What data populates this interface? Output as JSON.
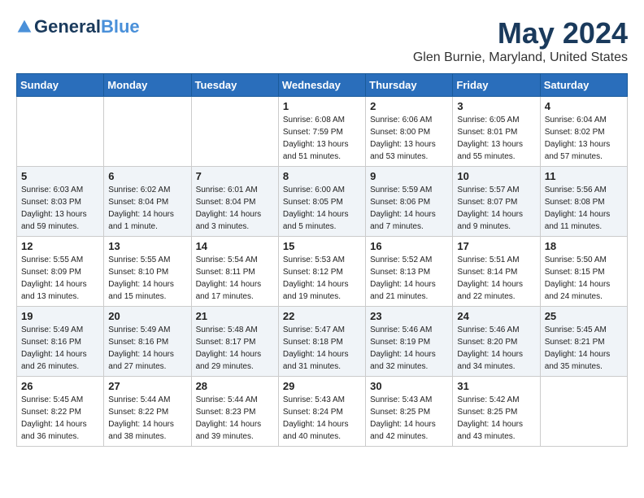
{
  "header": {
    "logo_general": "General",
    "logo_blue": "Blue",
    "month_year": "May 2024",
    "location": "Glen Burnie, Maryland, United States"
  },
  "days_of_week": [
    "Sunday",
    "Monday",
    "Tuesday",
    "Wednesday",
    "Thursday",
    "Friday",
    "Saturday"
  ],
  "weeks": [
    [
      {
        "day": "",
        "info": ""
      },
      {
        "day": "",
        "info": ""
      },
      {
        "day": "",
        "info": ""
      },
      {
        "day": "1",
        "info": "Sunrise: 6:08 AM\nSunset: 7:59 PM\nDaylight: 13 hours\nand 51 minutes."
      },
      {
        "day": "2",
        "info": "Sunrise: 6:06 AM\nSunset: 8:00 PM\nDaylight: 13 hours\nand 53 minutes."
      },
      {
        "day": "3",
        "info": "Sunrise: 6:05 AM\nSunset: 8:01 PM\nDaylight: 13 hours\nand 55 minutes."
      },
      {
        "day": "4",
        "info": "Sunrise: 6:04 AM\nSunset: 8:02 PM\nDaylight: 13 hours\nand 57 minutes."
      }
    ],
    [
      {
        "day": "5",
        "info": "Sunrise: 6:03 AM\nSunset: 8:03 PM\nDaylight: 13 hours\nand 59 minutes."
      },
      {
        "day": "6",
        "info": "Sunrise: 6:02 AM\nSunset: 8:04 PM\nDaylight: 14 hours\nand 1 minute."
      },
      {
        "day": "7",
        "info": "Sunrise: 6:01 AM\nSunset: 8:04 PM\nDaylight: 14 hours\nand 3 minutes."
      },
      {
        "day": "8",
        "info": "Sunrise: 6:00 AM\nSunset: 8:05 PM\nDaylight: 14 hours\nand 5 minutes."
      },
      {
        "day": "9",
        "info": "Sunrise: 5:59 AM\nSunset: 8:06 PM\nDaylight: 14 hours\nand 7 minutes."
      },
      {
        "day": "10",
        "info": "Sunrise: 5:57 AM\nSunset: 8:07 PM\nDaylight: 14 hours\nand 9 minutes."
      },
      {
        "day": "11",
        "info": "Sunrise: 5:56 AM\nSunset: 8:08 PM\nDaylight: 14 hours\nand 11 minutes."
      }
    ],
    [
      {
        "day": "12",
        "info": "Sunrise: 5:55 AM\nSunset: 8:09 PM\nDaylight: 14 hours\nand 13 minutes."
      },
      {
        "day": "13",
        "info": "Sunrise: 5:55 AM\nSunset: 8:10 PM\nDaylight: 14 hours\nand 15 minutes."
      },
      {
        "day": "14",
        "info": "Sunrise: 5:54 AM\nSunset: 8:11 PM\nDaylight: 14 hours\nand 17 minutes."
      },
      {
        "day": "15",
        "info": "Sunrise: 5:53 AM\nSunset: 8:12 PM\nDaylight: 14 hours\nand 19 minutes."
      },
      {
        "day": "16",
        "info": "Sunrise: 5:52 AM\nSunset: 8:13 PM\nDaylight: 14 hours\nand 21 minutes."
      },
      {
        "day": "17",
        "info": "Sunrise: 5:51 AM\nSunset: 8:14 PM\nDaylight: 14 hours\nand 22 minutes."
      },
      {
        "day": "18",
        "info": "Sunrise: 5:50 AM\nSunset: 8:15 PM\nDaylight: 14 hours\nand 24 minutes."
      }
    ],
    [
      {
        "day": "19",
        "info": "Sunrise: 5:49 AM\nSunset: 8:16 PM\nDaylight: 14 hours\nand 26 minutes."
      },
      {
        "day": "20",
        "info": "Sunrise: 5:49 AM\nSunset: 8:16 PM\nDaylight: 14 hours\nand 27 minutes."
      },
      {
        "day": "21",
        "info": "Sunrise: 5:48 AM\nSunset: 8:17 PM\nDaylight: 14 hours\nand 29 minutes."
      },
      {
        "day": "22",
        "info": "Sunrise: 5:47 AM\nSunset: 8:18 PM\nDaylight: 14 hours\nand 31 minutes."
      },
      {
        "day": "23",
        "info": "Sunrise: 5:46 AM\nSunset: 8:19 PM\nDaylight: 14 hours\nand 32 minutes."
      },
      {
        "day": "24",
        "info": "Sunrise: 5:46 AM\nSunset: 8:20 PM\nDaylight: 14 hours\nand 34 minutes."
      },
      {
        "day": "25",
        "info": "Sunrise: 5:45 AM\nSunset: 8:21 PM\nDaylight: 14 hours\nand 35 minutes."
      }
    ],
    [
      {
        "day": "26",
        "info": "Sunrise: 5:45 AM\nSunset: 8:22 PM\nDaylight: 14 hours\nand 36 minutes."
      },
      {
        "day": "27",
        "info": "Sunrise: 5:44 AM\nSunset: 8:22 PM\nDaylight: 14 hours\nand 38 minutes."
      },
      {
        "day": "28",
        "info": "Sunrise: 5:44 AM\nSunset: 8:23 PM\nDaylight: 14 hours\nand 39 minutes."
      },
      {
        "day": "29",
        "info": "Sunrise: 5:43 AM\nSunset: 8:24 PM\nDaylight: 14 hours\nand 40 minutes."
      },
      {
        "day": "30",
        "info": "Sunrise: 5:43 AM\nSunset: 8:25 PM\nDaylight: 14 hours\nand 42 minutes."
      },
      {
        "day": "31",
        "info": "Sunrise: 5:42 AM\nSunset: 8:25 PM\nDaylight: 14 hours\nand 43 minutes."
      },
      {
        "day": "",
        "info": ""
      }
    ]
  ]
}
